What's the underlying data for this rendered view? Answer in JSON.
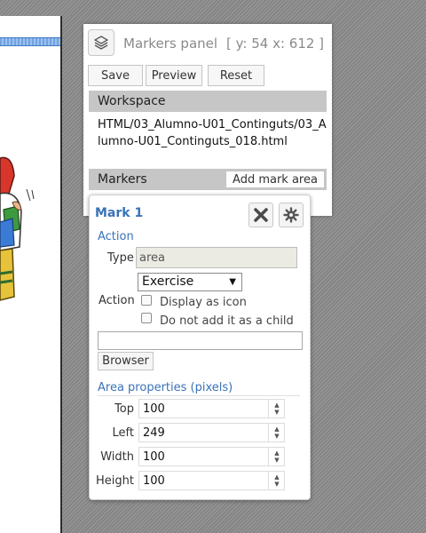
{
  "panel": {
    "title": "Markers panel",
    "coords": "[ y: 54 x: 612 ]",
    "toolbar": {
      "save_label": "Save",
      "preview_label": "Preview",
      "reset_label": "Reset"
    },
    "workspace": {
      "heading": "Workspace",
      "path": "HTML/03_Alumno-U01_Continguts/03_Alumno-U01_Continguts_018.html"
    },
    "markers": {
      "heading": "Markers",
      "add_label": "Add mark area"
    }
  },
  "mark": {
    "title": "Mark 1",
    "action_group": "Action",
    "type_label": "Type",
    "type_value": "area",
    "action_label": "Action",
    "action_selected": "Exercise",
    "display_as_icon_label": "Display as icon",
    "display_as_icon_checked": false,
    "not_child_label": "Do not add it as a child",
    "not_child_checked": false,
    "file_value": "",
    "browser_label": "Browser",
    "area_group": "Area properties (pixels)",
    "fields": [
      {
        "label": "Top",
        "value": "100"
      },
      {
        "label": "Left",
        "value": "249"
      },
      {
        "label": "Width",
        "value": "100"
      },
      {
        "label": "Height",
        "value": "100"
      }
    ]
  },
  "colors": {
    "accent": "#3a72b8",
    "section_bar": "#c6c6c6",
    "background": "#8f8f8f"
  },
  "icons": {
    "layers": "layers-icon",
    "delete": "close-x-icon",
    "settings": "gear-icon"
  }
}
